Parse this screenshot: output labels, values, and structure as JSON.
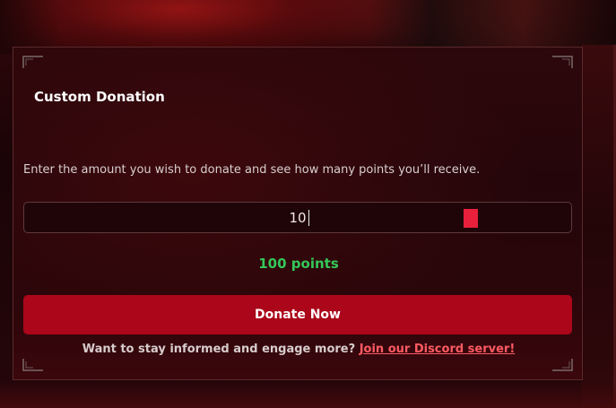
{
  "donation": {
    "title": "Custom Donation",
    "description": "Enter the amount you wish to donate and see how many points you’ll receive.",
    "amount_value": "10",
    "points_text": "100 points",
    "donate_label": "Donate Now",
    "footer_text": "Want to stay informed and engage more?",
    "discord_link_label": "Join our Discord server!"
  },
  "colors": {
    "accent": "#ab0619",
    "points": "#35c75a",
    "link": "#ff5a62",
    "stepper": "#e8203c"
  }
}
